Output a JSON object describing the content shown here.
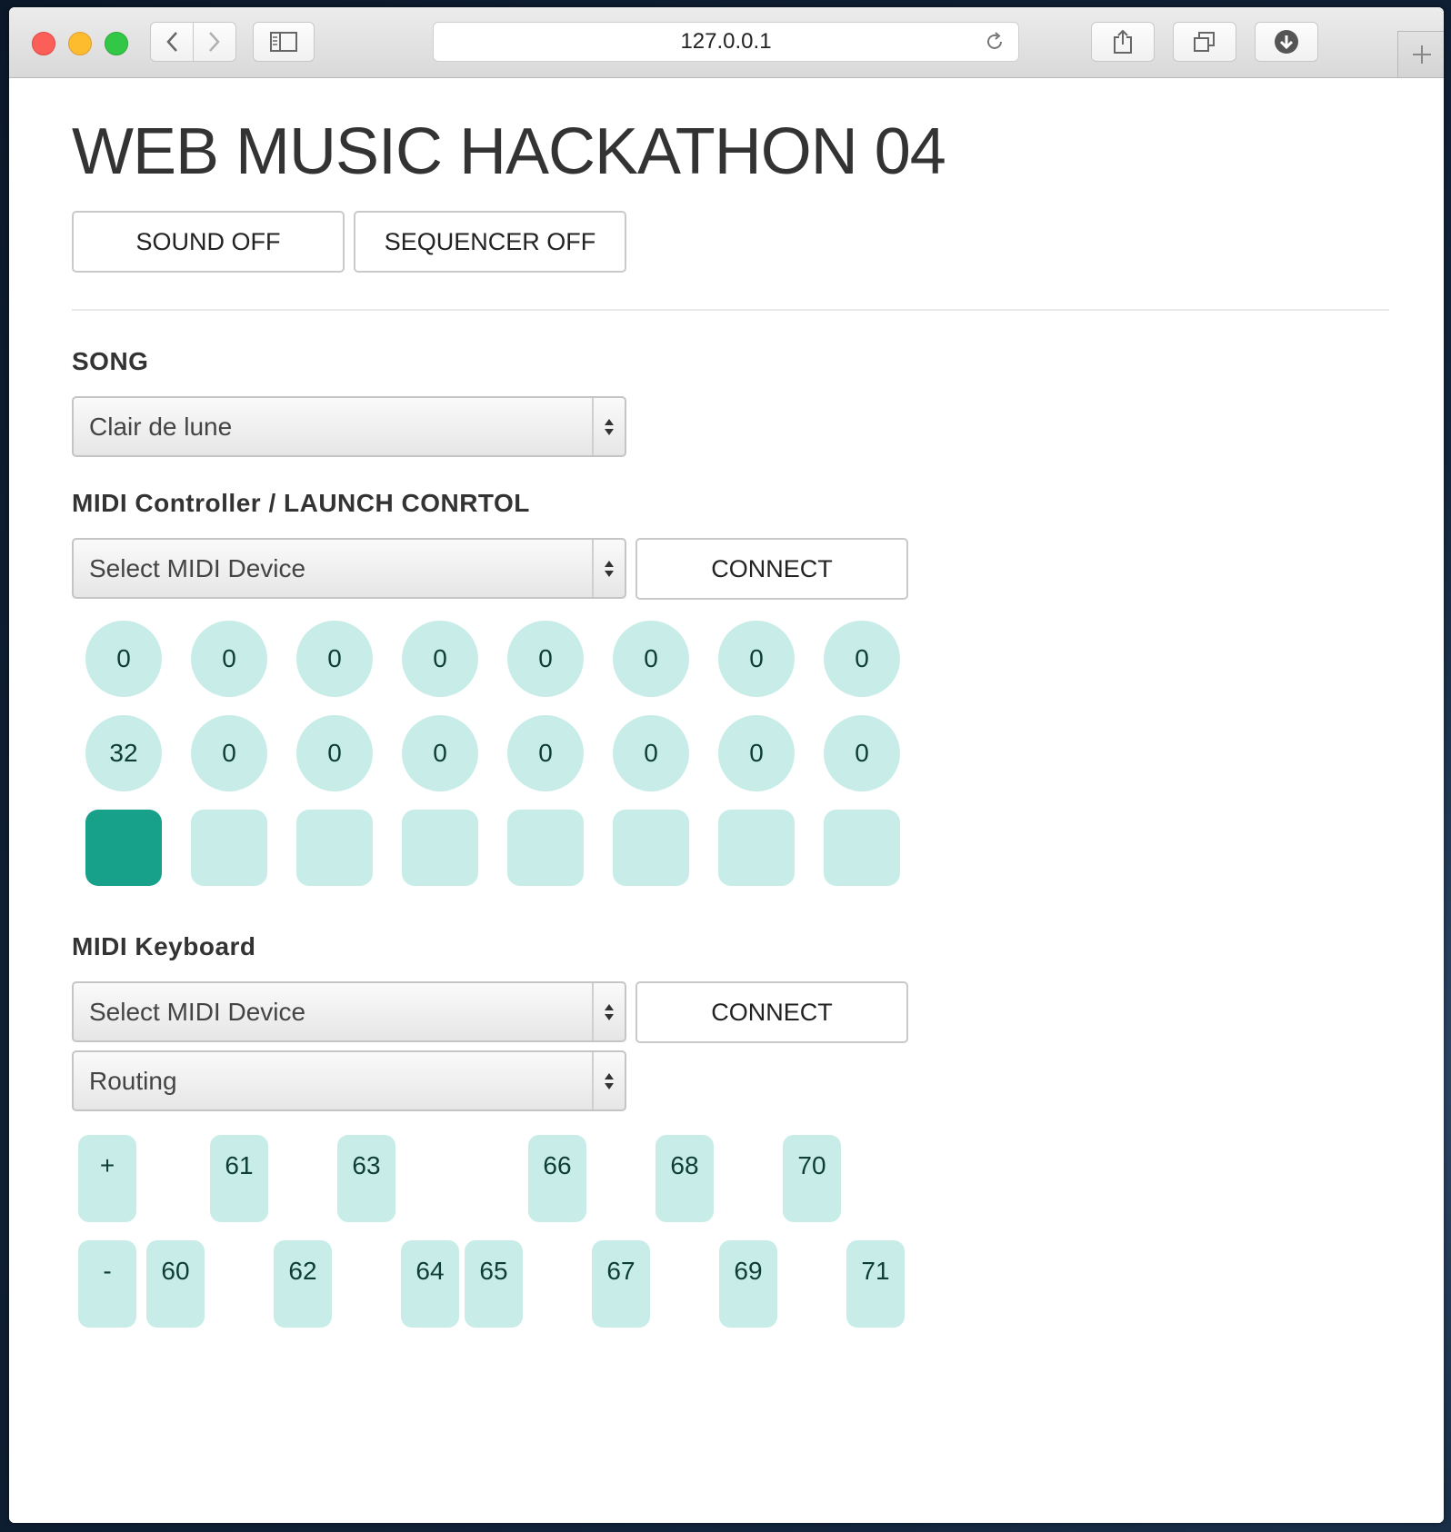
{
  "browser": {
    "url": "127.0.0.1"
  },
  "page": {
    "title": "WEB MUSIC HACKATHON 04",
    "sound_button": "SOUND OFF",
    "sequencer_button": "SEQUENCER OFF"
  },
  "song": {
    "label": "SONG",
    "selected": "Clair de lune"
  },
  "controller": {
    "label": "MIDI Controller / LAUNCH CONRTOL",
    "device_selected": "Select MIDI Device",
    "connect_label": "CONNECT",
    "knobs_row1": [
      "0",
      "0",
      "0",
      "0",
      "0",
      "0",
      "0",
      "0"
    ],
    "knobs_row2": [
      "32",
      "0",
      "0",
      "0",
      "0",
      "0",
      "0",
      "0"
    ],
    "pads_active": [
      true,
      false,
      false,
      false,
      false,
      false,
      false,
      false
    ],
    "colors": {
      "knob": "#c8ede8",
      "pad_active": "#17a08a"
    }
  },
  "keyboard": {
    "label": "MIDI Keyboard",
    "device_selected": "Select MIDI Device",
    "connect_label": "CONNECT",
    "routing_selected": "Routing",
    "octave_up": "+",
    "octave_down": "-",
    "black_keys": [
      "61",
      "63",
      "66",
      "68",
      "70"
    ],
    "white_keys": [
      "60",
      "62",
      "64",
      "65",
      "67",
      "69",
      "71"
    ]
  }
}
